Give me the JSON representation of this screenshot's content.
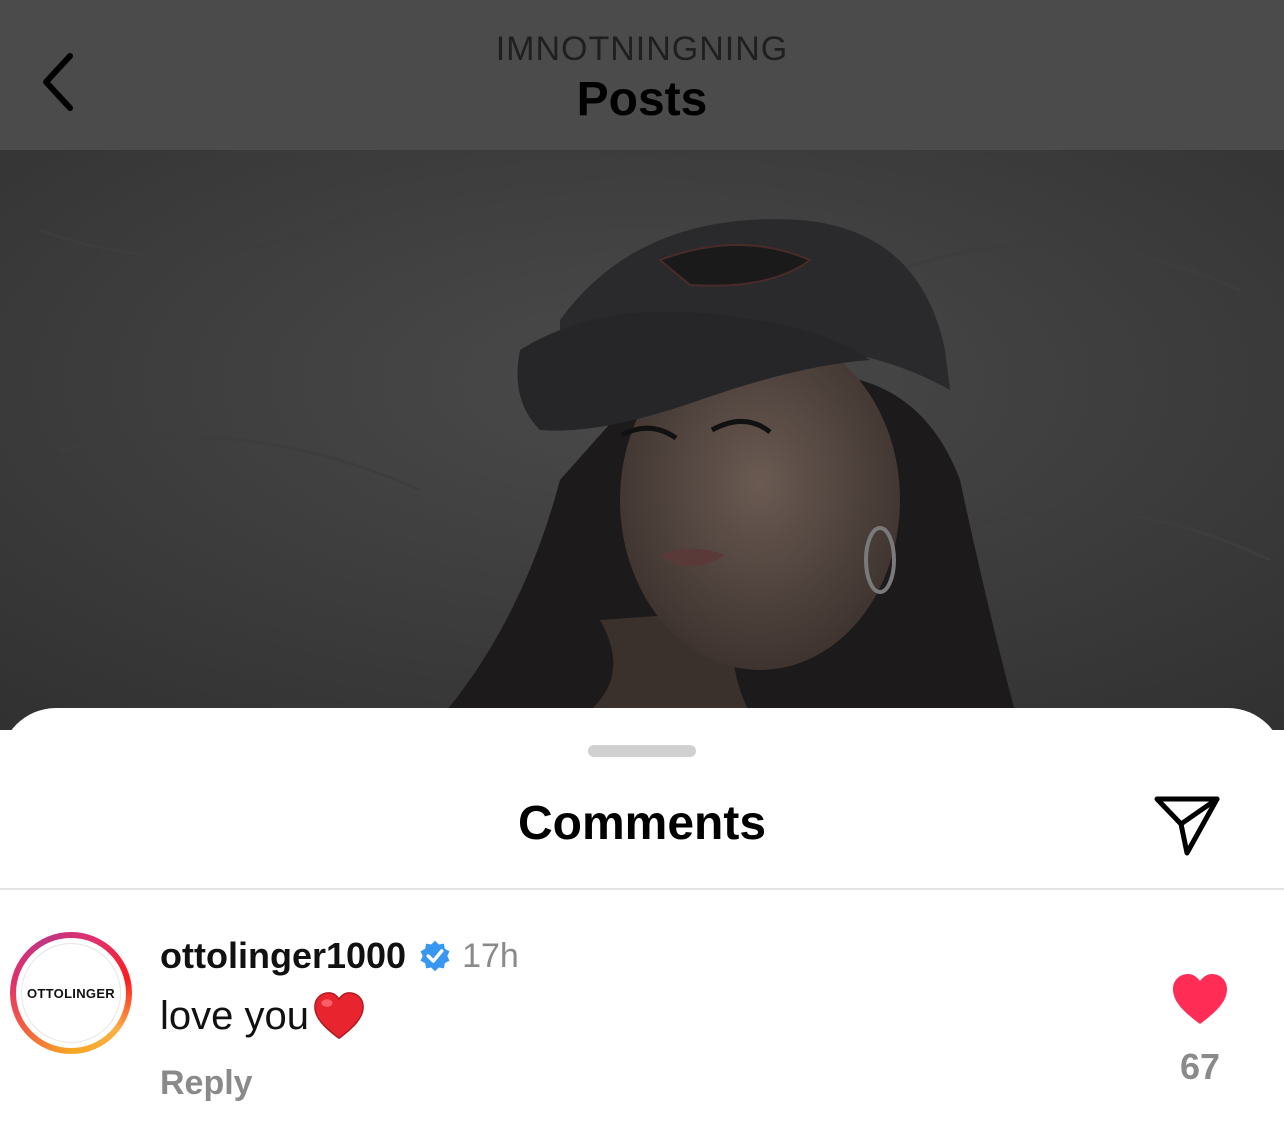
{
  "header": {
    "username": "IMNOTNINGNING",
    "title": "Posts",
    "back_icon": "chevron-left-icon"
  },
  "post": {
    "image": "photo of a woman wearing a baseball cap and hoop earrings (dimmed)"
  },
  "comments_sheet": {
    "title": "Comments",
    "share_icon": "paper-plane-icon",
    "comment": {
      "avatar_text": "OTTOLINGER",
      "username": "ottolinger1000",
      "verified": true,
      "time": "17h",
      "text": "love you",
      "emoji": "red-heart",
      "reply_label": "Reply",
      "like_count": "67",
      "liked": true
    }
  },
  "colors": {
    "like_red": "#ff2d55",
    "verified_blue": "#3897f0",
    "muted_gray": "#8a8a8a"
  }
}
